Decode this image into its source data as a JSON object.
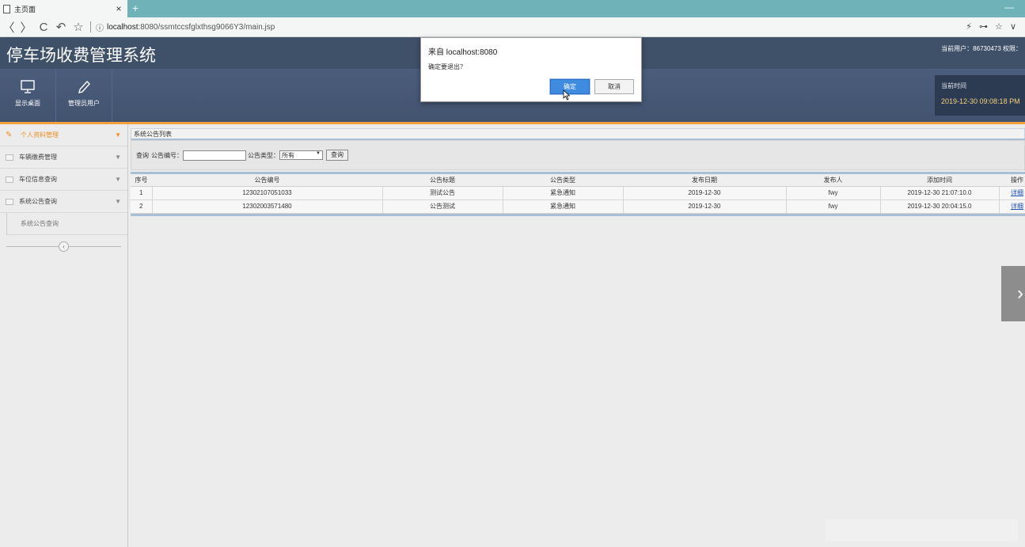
{
  "browser": {
    "tab_title": "主页面",
    "tab_close": "×",
    "new_tab": "+",
    "win_min": "—",
    "nav_back": "〈",
    "nav_forward": "〉",
    "nav_reload": "C",
    "nav_undo": "↶",
    "nav_star": "☆",
    "url_host": "localhost",
    "url_rest": ":8080/ssmtccsfglxthsg9066Y3/main.jsp",
    "info_icon": "ⓘ",
    "right_icons": "⚡ ⊶ ☆ ∨"
  },
  "header": {
    "app_title": "停车场收费管理系统",
    "user_info": "当前用户：86730473  权限："
  },
  "toolbar": {
    "items": [
      {
        "label": "显示桌面",
        "icon": "monitor-icon"
      },
      {
        "label": "管理员用户",
        "icon": "pencil-icon"
      }
    ]
  },
  "time_box": {
    "label": "当前时间",
    "value": "2019-12-30 09:08:18 PM"
  },
  "sidebar": {
    "items": [
      {
        "label": "个人资料管理",
        "active": true
      },
      {
        "label": "车辆缴费管理",
        "active": false
      },
      {
        "label": "车位信息查询",
        "active": false
      },
      {
        "label": "系统公告查询",
        "active": false
      }
    ],
    "sub_items": [
      "系统公告查询"
    ],
    "arrow": "▼",
    "collapse": "‹"
  },
  "main": {
    "panel_title": "系统公告列表",
    "query": {
      "prefix": "查询",
      "code_label": "公告编号：",
      "code_value": "",
      "type_label": "公告类型：",
      "type_selected": "所有",
      "button": "查询"
    },
    "table": {
      "headers": [
        "序号",
        "公告编号",
        "公告标题",
        "公告类型",
        "发布日期",
        "发布人",
        "添加时间",
        "操作"
      ],
      "rows": [
        [
          "1",
          "12302107051033",
          "测试公告",
          "紧急通知",
          "2019-12-30",
          "fwy",
          "2019-12-30 21:07:10.0",
          "详细"
        ],
        [
          "2",
          "12302003571480",
          "公告测试",
          "紧急通知",
          "2019-12-30",
          "fwy",
          "2019-12-30 20:04:15.0",
          "详细"
        ]
      ]
    }
  },
  "dialog": {
    "title": "来自 localhost:8080",
    "message": "确定要退出？",
    "ok": "确定",
    "cancel": "取消"
  },
  "side_arrow": "›",
  "colors": {
    "header_bg": "#3f5069",
    "accent_orange": "#f39f3b",
    "tab_bar": "#6fb3b8",
    "ok_button": "#3f8be0",
    "time_text": "#f3d27b"
  }
}
